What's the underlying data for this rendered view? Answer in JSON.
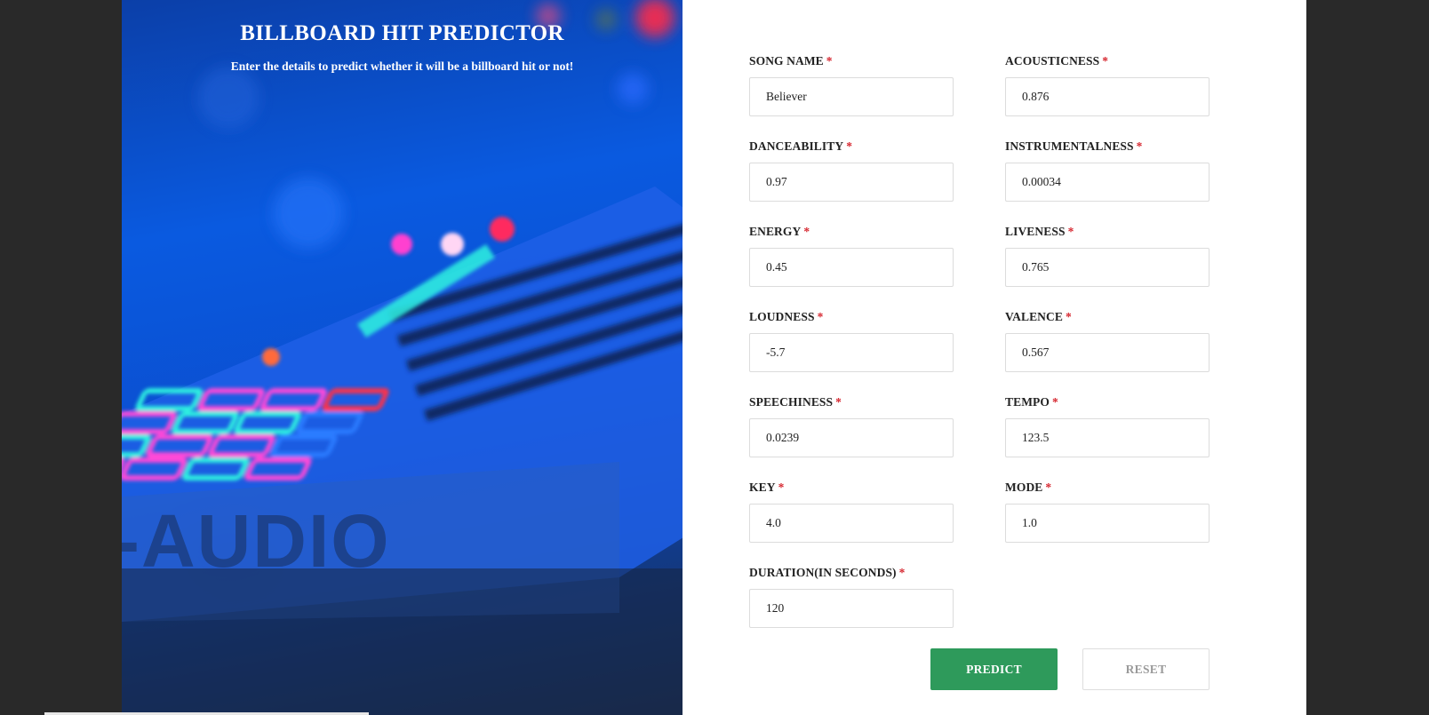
{
  "header": {
    "title": "BILLBOARD HIT PREDICTOR",
    "subtitle": "Enter the details to predict whether it will be a billboard hit or not!"
  },
  "hero_image": {
    "icon": "midi-keyboard-photo",
    "brand_text": "-AUDIO"
  },
  "form": {
    "required_marker": "*",
    "fields": {
      "song_name": {
        "label": "SONG NAME",
        "value": "Believer"
      },
      "acousticness": {
        "label": "ACOUSTICNESS",
        "value": "0.876"
      },
      "danceability": {
        "label": "DANCEABILITY",
        "value": "0.97"
      },
      "instrumentalness": {
        "label": "INSTRUMENTALNESS",
        "value": "0.00034"
      },
      "energy": {
        "label": "ENERGY",
        "value": "0.45"
      },
      "liveness": {
        "label": "LIVENESS",
        "value": "0.765"
      },
      "loudness": {
        "label": "LOUDNESS",
        "value": "-5.7"
      },
      "valence": {
        "label": "VALENCE",
        "value": "0.567"
      },
      "speechiness": {
        "label": "SPEECHINESS",
        "value": "0.0239"
      },
      "tempo": {
        "label": "TEMPO",
        "value": "123.5"
      },
      "key": {
        "label": "KEY",
        "value": "4.0"
      },
      "mode": {
        "label": "MODE",
        "value": "1.0"
      },
      "duration": {
        "label": "DURATION(IN SECONDS)",
        "value": "120"
      }
    },
    "buttons": {
      "predict_label": "PREDICT",
      "reset_label": "RESET"
    }
  },
  "colors": {
    "primary_button": "#2e9a5b",
    "required_marker": "#d6262f",
    "page_background": "#292929"
  }
}
